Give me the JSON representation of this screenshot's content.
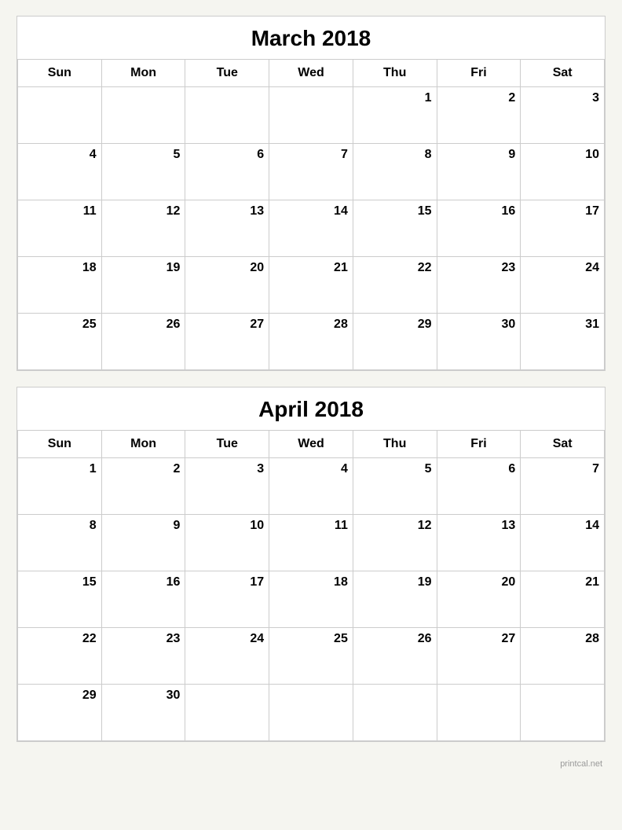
{
  "march": {
    "title": "March 2018",
    "headers": [
      "Sun",
      "Mon",
      "Tue",
      "Wed",
      "Thu",
      "Fri",
      "Sat"
    ],
    "weeks": [
      [
        {
          "day": "",
          "empty": true
        },
        {
          "day": "",
          "empty": true
        },
        {
          "day": "",
          "empty": true
        },
        {
          "day": "",
          "empty": true
        },
        {
          "day": "1",
          "empty": false
        },
        {
          "day": "2",
          "empty": false
        },
        {
          "day": "3",
          "empty": false
        }
      ],
      [
        {
          "day": "4",
          "empty": false
        },
        {
          "day": "5",
          "empty": false
        },
        {
          "day": "6",
          "empty": false
        },
        {
          "day": "7",
          "empty": false
        },
        {
          "day": "8",
          "empty": false
        },
        {
          "day": "9",
          "empty": false
        },
        {
          "day": "10",
          "empty": false
        }
      ],
      [
        {
          "day": "11",
          "empty": false
        },
        {
          "day": "12",
          "empty": false
        },
        {
          "day": "13",
          "empty": false
        },
        {
          "day": "14",
          "empty": false
        },
        {
          "day": "15",
          "empty": false
        },
        {
          "day": "16",
          "empty": false
        },
        {
          "day": "17",
          "empty": false
        }
      ],
      [
        {
          "day": "18",
          "empty": false
        },
        {
          "day": "19",
          "empty": false
        },
        {
          "day": "20",
          "empty": false
        },
        {
          "day": "21",
          "empty": false
        },
        {
          "day": "22",
          "empty": false
        },
        {
          "day": "23",
          "empty": false
        },
        {
          "day": "24",
          "empty": false
        }
      ],
      [
        {
          "day": "25",
          "empty": false
        },
        {
          "day": "26",
          "empty": false
        },
        {
          "day": "27",
          "empty": false
        },
        {
          "day": "28",
          "empty": false
        },
        {
          "day": "29",
          "empty": false
        },
        {
          "day": "30",
          "empty": false
        },
        {
          "day": "31",
          "empty": false
        }
      ]
    ]
  },
  "april": {
    "title": "April 2018",
    "headers": [
      "Sun",
      "Mon",
      "Tue",
      "Wed",
      "Thu",
      "Fri",
      "Sat"
    ],
    "weeks": [
      [
        {
          "day": "1",
          "empty": false
        },
        {
          "day": "2",
          "empty": false
        },
        {
          "day": "3",
          "empty": false
        },
        {
          "day": "4",
          "empty": false
        },
        {
          "day": "5",
          "empty": false
        },
        {
          "day": "6",
          "empty": false
        },
        {
          "day": "7",
          "empty": false
        }
      ],
      [
        {
          "day": "8",
          "empty": false
        },
        {
          "day": "9",
          "empty": false
        },
        {
          "day": "10",
          "empty": false
        },
        {
          "day": "11",
          "empty": false
        },
        {
          "day": "12",
          "empty": false
        },
        {
          "day": "13",
          "empty": false
        },
        {
          "day": "14",
          "empty": false
        }
      ],
      [
        {
          "day": "15",
          "empty": false
        },
        {
          "day": "16",
          "empty": false
        },
        {
          "day": "17",
          "empty": false
        },
        {
          "day": "18",
          "empty": false
        },
        {
          "day": "19",
          "empty": false
        },
        {
          "day": "20",
          "empty": false
        },
        {
          "day": "21",
          "empty": false
        }
      ],
      [
        {
          "day": "22",
          "empty": false
        },
        {
          "day": "23",
          "empty": false
        },
        {
          "day": "24",
          "empty": false
        },
        {
          "day": "25",
          "empty": false
        },
        {
          "day": "26",
          "empty": false
        },
        {
          "day": "27",
          "empty": false
        },
        {
          "day": "28",
          "empty": false
        }
      ],
      [
        {
          "day": "29",
          "empty": false
        },
        {
          "day": "30",
          "empty": false
        },
        {
          "day": "",
          "empty": true
        },
        {
          "day": "",
          "empty": true
        },
        {
          "day": "",
          "empty": true
        },
        {
          "day": "",
          "empty": true
        },
        {
          "day": "",
          "empty": true
        }
      ]
    ]
  },
  "watermark": "printcal.net"
}
